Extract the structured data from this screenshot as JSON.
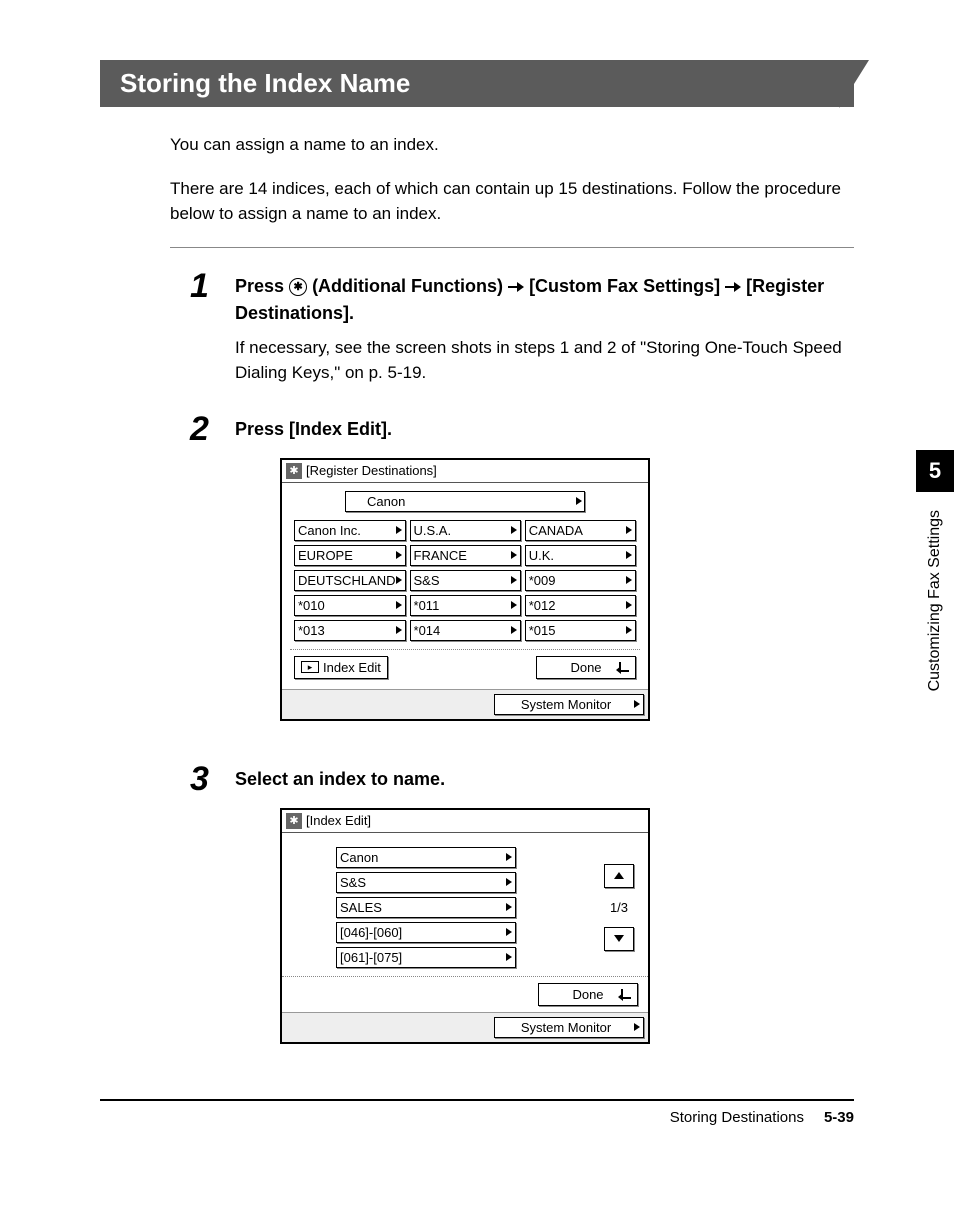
{
  "title": "Storing the Index Name",
  "intro1": "You can assign a name to an index.",
  "intro2": "There are 14 indices, each of which can contain up 15 destinations. Follow the procedure below to assign a name to an index.",
  "steps": {
    "s1": {
      "num": "1",
      "pre": "Press ",
      "af": " (Additional Functions) ",
      "seg1": " [Custom Fax Settings] ",
      "seg2": " [Register Destinations].",
      "sub": "If necessary, see the screen shots in steps 1 and 2 of \"Storing One-Touch Speed Dialing Keys,\" on p. 5-19."
    },
    "s2": {
      "num": "2",
      "heading": "Press [Index Edit]."
    },
    "s3": {
      "num": "3",
      "heading": "Select an index to name."
    }
  },
  "screen1": {
    "title": "[Register Destinations]",
    "selected": "Canon",
    "cells": [
      "Canon Inc.",
      "U.S.A.",
      "CANADA",
      "EUROPE",
      "FRANCE",
      "U.K.",
      "DEUTSCHLAND",
      "S&S",
      "*009",
      "*010",
      "*011",
      "*012",
      "*013",
      "*014",
      "*015"
    ],
    "index_edit": "Index Edit",
    "done": "Done",
    "sysmon": "System Monitor"
  },
  "screen2": {
    "title": "[Index Edit]",
    "items": [
      "Canon",
      "S&S",
      "SALES",
      "[046]-[060]",
      "[061]-[075]"
    ],
    "page": "1/3",
    "done": "Done",
    "sysmon": "System Monitor"
  },
  "sidebar": {
    "chapter": "5",
    "label": "Customizing Fax Settings"
  },
  "footer": {
    "section": "Storing Destinations",
    "page": "5-39"
  }
}
